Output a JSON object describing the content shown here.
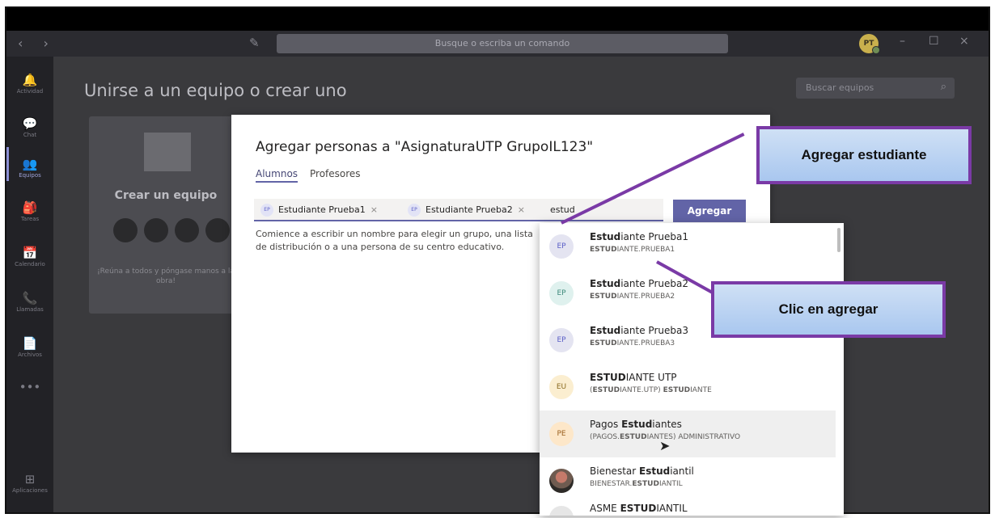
{
  "window": {
    "search_placeholder": "Busque o escriba un comando",
    "avatar_initials": "PT",
    "controls": [
      "–",
      "☐",
      "×"
    ],
    "nav_arrows": "‹ ›"
  },
  "rail": {
    "items": [
      {
        "icon": "bell-icon",
        "glyph": "🔔",
        "label": "Actividad"
      },
      {
        "icon": "chat-icon",
        "glyph": "💬",
        "label": "Chat"
      },
      {
        "icon": "teams-icon",
        "glyph": "👥",
        "label": "Equipos"
      },
      {
        "icon": "tasks-icon",
        "glyph": "🎒",
        "label": "Tareas"
      },
      {
        "icon": "calendar-icon",
        "glyph": "📅",
        "label": "Calendario"
      },
      {
        "icon": "phone-icon",
        "glyph": "📞",
        "label": "Llamadas"
      },
      {
        "icon": "files-icon",
        "glyph": "📄",
        "label": "Archivos"
      },
      {
        "icon": "more-icon",
        "glyph": "•••",
        "label": ""
      },
      {
        "icon": "apps-icon",
        "glyph": "⊞",
        "label": "Aplicaciones"
      }
    ]
  },
  "page": {
    "title": "Unirse a un equipo o crear uno",
    "team_search_placeholder": "Buscar equipos"
  },
  "create_card": {
    "title": "Crear un equipo",
    "subtitle": "¡Reúna a todos y póngase manos a la obra!"
  },
  "dialog": {
    "title": "Agregar personas a \"AsignaturaUTP GrupoIL123\"",
    "tabs": [
      "Alumnos",
      "Profesores"
    ],
    "tokens": [
      {
        "badge": "EP",
        "name": "Estudiante Prueba1"
      },
      {
        "badge": "EP",
        "name": "Estudiante Prueba2"
      }
    ],
    "typed": "estud",
    "add_button": "Agregar",
    "hint": "Comience a escribir un nombre para elegir un grupo, una lista de distribución o a una persona de su centro educativo."
  },
  "suggestions": [
    {
      "badge": "EP",
      "name_bold": "Estud",
      "name_rest": "iante Prueba1",
      "sub_bold": "ESTUD",
      "sub_rest": "IANTE.PRUEBA1"
    },
    {
      "badge": "EP",
      "name_bold": "Estud",
      "name_rest": "iante Prueba2",
      "sub_bold": "ESTUD",
      "sub_rest": "IANTE.PRUEBA2"
    },
    {
      "badge": "EP",
      "name_bold": "Estud",
      "name_rest": "iante Prueba3",
      "sub_bold": "ESTUD",
      "sub_rest": "IANTE.PRUEBA3"
    },
    {
      "badge": "EU",
      "name_bold": "ESTUD",
      "name_rest": "IANTE UTP",
      "sub_pre": "(",
      "sub_bold": "ESTUD",
      "sub_mid": "IANTE.UTP) ",
      "sub_bold2": "ESTUD",
      "sub_rest": "IANTE"
    },
    {
      "badge": "PE",
      "name_pre": "Pagos ",
      "name_bold": "Estud",
      "name_rest": "iantes",
      "sub_pre": "(PAGOS.",
      "sub_bold": "ESTUD",
      "sub_rest": "IANTES) ADMINISTRATIVO"
    },
    {
      "badge": "",
      "name_pre": "Bienestar ",
      "name_bold": "Estud",
      "name_rest": "iantil",
      "sub_pre": "BIENESTAR.",
      "sub_bold": "ESTUD",
      "sub_rest": "IANTIL"
    },
    {
      "badge": "",
      "name_pre": "ASME ",
      "name_bold": "ESTUD",
      "name_rest": "IANTIL"
    }
  ],
  "callouts": {
    "add_student": "Agregar estudiante",
    "click_add": "Clic en agregar"
  },
  "colors": {
    "accent": "#6264a7",
    "callout_border": "#7a3aa6",
    "callout_fill": "#b9d3f2"
  }
}
